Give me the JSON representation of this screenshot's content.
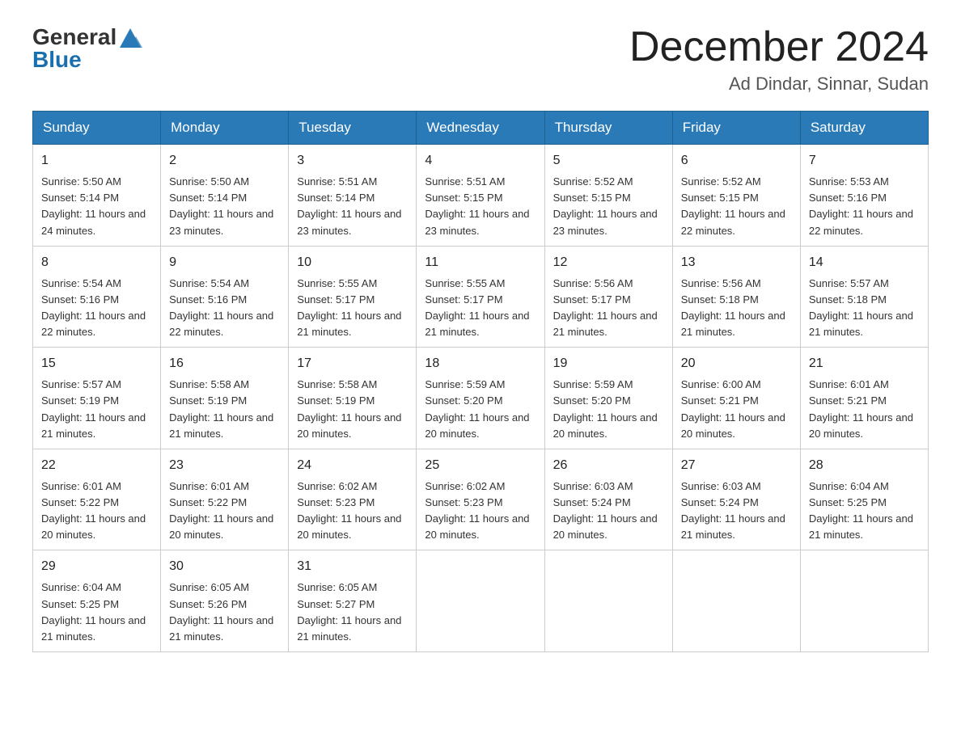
{
  "header": {
    "logo_general": "General",
    "logo_blue": "Blue",
    "month_title": "December 2024",
    "location": "Ad Dindar, Sinnar, Sudan"
  },
  "columns": [
    "Sunday",
    "Monday",
    "Tuesday",
    "Wednesday",
    "Thursday",
    "Friday",
    "Saturday"
  ],
  "weeks": [
    [
      {
        "day": "1",
        "sunrise": "Sunrise: 5:50 AM",
        "sunset": "Sunset: 5:14 PM",
        "daylight": "Daylight: 11 hours and 24 minutes."
      },
      {
        "day": "2",
        "sunrise": "Sunrise: 5:50 AM",
        "sunset": "Sunset: 5:14 PM",
        "daylight": "Daylight: 11 hours and 23 minutes."
      },
      {
        "day": "3",
        "sunrise": "Sunrise: 5:51 AM",
        "sunset": "Sunset: 5:14 PM",
        "daylight": "Daylight: 11 hours and 23 minutes."
      },
      {
        "day": "4",
        "sunrise": "Sunrise: 5:51 AM",
        "sunset": "Sunset: 5:15 PM",
        "daylight": "Daylight: 11 hours and 23 minutes."
      },
      {
        "day": "5",
        "sunrise": "Sunrise: 5:52 AM",
        "sunset": "Sunset: 5:15 PM",
        "daylight": "Daylight: 11 hours and 23 minutes."
      },
      {
        "day": "6",
        "sunrise": "Sunrise: 5:52 AM",
        "sunset": "Sunset: 5:15 PM",
        "daylight": "Daylight: 11 hours and 22 minutes."
      },
      {
        "day": "7",
        "sunrise": "Sunrise: 5:53 AM",
        "sunset": "Sunset: 5:16 PM",
        "daylight": "Daylight: 11 hours and 22 minutes."
      }
    ],
    [
      {
        "day": "8",
        "sunrise": "Sunrise: 5:54 AM",
        "sunset": "Sunset: 5:16 PM",
        "daylight": "Daylight: 11 hours and 22 minutes."
      },
      {
        "day": "9",
        "sunrise": "Sunrise: 5:54 AM",
        "sunset": "Sunset: 5:16 PM",
        "daylight": "Daylight: 11 hours and 22 minutes."
      },
      {
        "day": "10",
        "sunrise": "Sunrise: 5:55 AM",
        "sunset": "Sunset: 5:17 PM",
        "daylight": "Daylight: 11 hours and 21 minutes."
      },
      {
        "day": "11",
        "sunrise": "Sunrise: 5:55 AM",
        "sunset": "Sunset: 5:17 PM",
        "daylight": "Daylight: 11 hours and 21 minutes."
      },
      {
        "day": "12",
        "sunrise": "Sunrise: 5:56 AM",
        "sunset": "Sunset: 5:17 PM",
        "daylight": "Daylight: 11 hours and 21 minutes."
      },
      {
        "day": "13",
        "sunrise": "Sunrise: 5:56 AM",
        "sunset": "Sunset: 5:18 PM",
        "daylight": "Daylight: 11 hours and 21 minutes."
      },
      {
        "day": "14",
        "sunrise": "Sunrise: 5:57 AM",
        "sunset": "Sunset: 5:18 PM",
        "daylight": "Daylight: 11 hours and 21 minutes."
      }
    ],
    [
      {
        "day": "15",
        "sunrise": "Sunrise: 5:57 AM",
        "sunset": "Sunset: 5:19 PM",
        "daylight": "Daylight: 11 hours and 21 minutes."
      },
      {
        "day": "16",
        "sunrise": "Sunrise: 5:58 AM",
        "sunset": "Sunset: 5:19 PM",
        "daylight": "Daylight: 11 hours and 21 minutes."
      },
      {
        "day": "17",
        "sunrise": "Sunrise: 5:58 AM",
        "sunset": "Sunset: 5:19 PM",
        "daylight": "Daylight: 11 hours and 20 minutes."
      },
      {
        "day": "18",
        "sunrise": "Sunrise: 5:59 AM",
        "sunset": "Sunset: 5:20 PM",
        "daylight": "Daylight: 11 hours and 20 minutes."
      },
      {
        "day": "19",
        "sunrise": "Sunrise: 5:59 AM",
        "sunset": "Sunset: 5:20 PM",
        "daylight": "Daylight: 11 hours and 20 minutes."
      },
      {
        "day": "20",
        "sunrise": "Sunrise: 6:00 AM",
        "sunset": "Sunset: 5:21 PM",
        "daylight": "Daylight: 11 hours and 20 minutes."
      },
      {
        "day": "21",
        "sunrise": "Sunrise: 6:01 AM",
        "sunset": "Sunset: 5:21 PM",
        "daylight": "Daylight: 11 hours and 20 minutes."
      }
    ],
    [
      {
        "day": "22",
        "sunrise": "Sunrise: 6:01 AM",
        "sunset": "Sunset: 5:22 PM",
        "daylight": "Daylight: 11 hours and 20 minutes."
      },
      {
        "day": "23",
        "sunrise": "Sunrise: 6:01 AM",
        "sunset": "Sunset: 5:22 PM",
        "daylight": "Daylight: 11 hours and 20 minutes."
      },
      {
        "day": "24",
        "sunrise": "Sunrise: 6:02 AM",
        "sunset": "Sunset: 5:23 PM",
        "daylight": "Daylight: 11 hours and 20 minutes."
      },
      {
        "day": "25",
        "sunrise": "Sunrise: 6:02 AM",
        "sunset": "Sunset: 5:23 PM",
        "daylight": "Daylight: 11 hours and 20 minutes."
      },
      {
        "day": "26",
        "sunrise": "Sunrise: 6:03 AM",
        "sunset": "Sunset: 5:24 PM",
        "daylight": "Daylight: 11 hours and 20 minutes."
      },
      {
        "day": "27",
        "sunrise": "Sunrise: 6:03 AM",
        "sunset": "Sunset: 5:24 PM",
        "daylight": "Daylight: 11 hours and 21 minutes."
      },
      {
        "day": "28",
        "sunrise": "Sunrise: 6:04 AM",
        "sunset": "Sunset: 5:25 PM",
        "daylight": "Daylight: 11 hours and 21 minutes."
      }
    ],
    [
      {
        "day": "29",
        "sunrise": "Sunrise: 6:04 AM",
        "sunset": "Sunset: 5:25 PM",
        "daylight": "Daylight: 11 hours and 21 minutes."
      },
      {
        "day": "30",
        "sunrise": "Sunrise: 6:05 AM",
        "sunset": "Sunset: 5:26 PM",
        "daylight": "Daylight: 11 hours and 21 minutes."
      },
      {
        "day": "31",
        "sunrise": "Sunrise: 6:05 AM",
        "sunset": "Sunset: 5:27 PM",
        "daylight": "Daylight: 11 hours and 21 minutes."
      },
      null,
      null,
      null,
      null
    ]
  ]
}
